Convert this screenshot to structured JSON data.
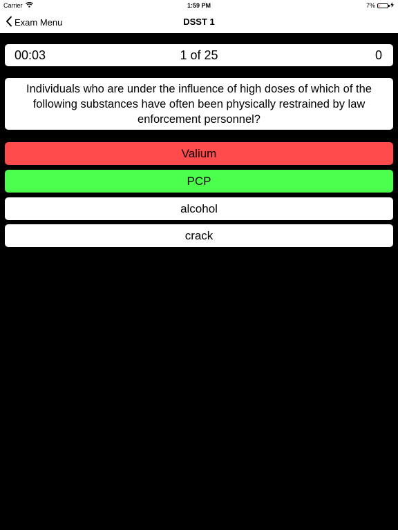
{
  "status_bar": {
    "carrier": "Carrier",
    "time": "1:59 PM",
    "battery": "7%",
    "battery_level": 0.07,
    "battery_color": "#ff3b30"
  },
  "nav": {
    "back_label": "Exam Menu",
    "title": "DSST 1"
  },
  "quiz": {
    "timer": "00:03",
    "progress": "1 of 25",
    "score": "0"
  },
  "question": {
    "text": "Individuals who are under the influence of high doses of which of the following substances have often been physically restrained by law enforcement personnel?"
  },
  "answers": [
    {
      "label": "Valium",
      "state": "incorrect",
      "color": "#ff4b4b"
    },
    {
      "label": "PCP",
      "state": "correct",
      "color": "#4cff4c"
    },
    {
      "label": "alcohol",
      "state": "neutral",
      "color": "#ffffff"
    },
    {
      "label": "crack",
      "state": "neutral",
      "color": "#ffffff"
    }
  ],
  "icons": {
    "wifi": "wifi-icon",
    "back": "chevron-left-icon",
    "battery": "battery-icon",
    "charging": "bolt-icon"
  }
}
